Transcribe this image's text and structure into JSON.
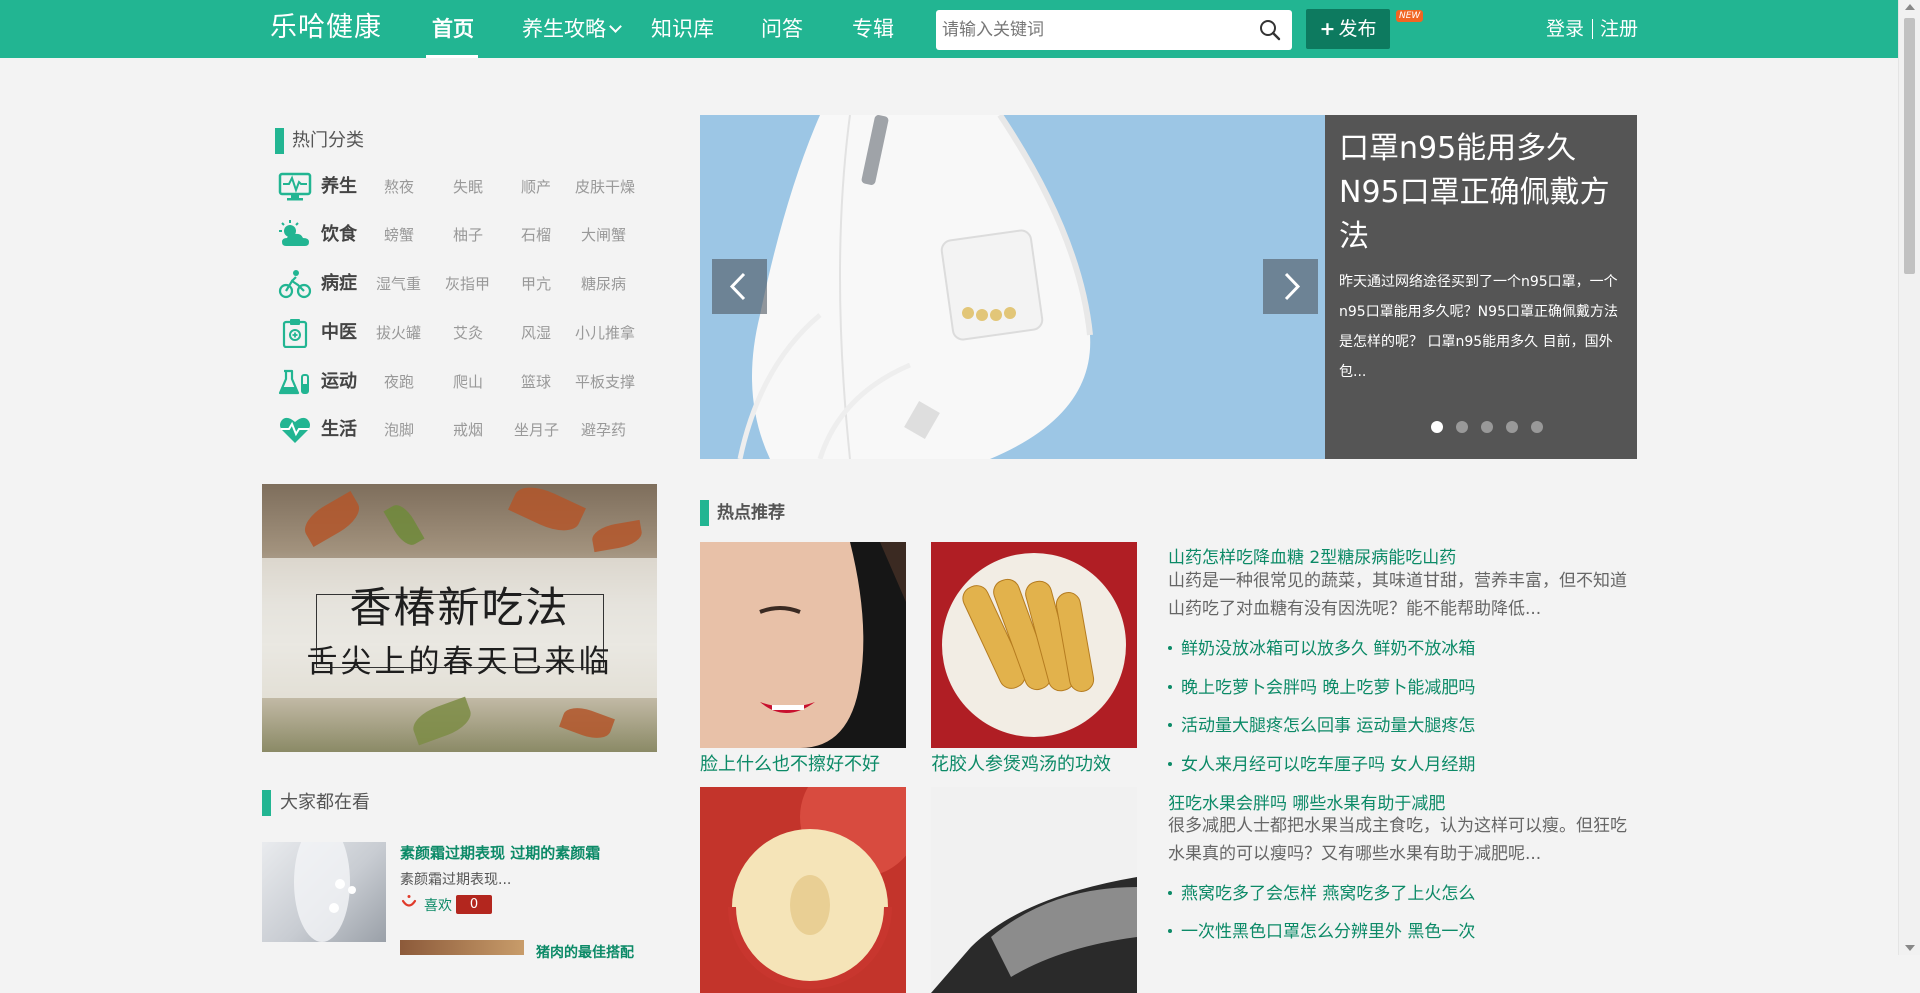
{
  "header": {
    "logo": "乐哈健康",
    "nav": [
      {
        "label": "首页",
        "active": true
      },
      {
        "label": "养生攻略",
        "has_dropdown": true
      },
      {
        "label": "知识库"
      },
      {
        "label": "问答"
      },
      {
        "label": "专辑"
      }
    ],
    "search_placeholder": "请输入关键词",
    "publish_label": "发布",
    "new_badge": "NEW",
    "login": "登录",
    "register": "注册"
  },
  "hot_categories": {
    "title": "热门分类",
    "rows": [
      {
        "icon": "monitor-pulse-icon",
        "name": "养生",
        "tags": [
          "熬夜",
          "失眠",
          "顺产",
          "皮肤干燥"
        ]
      },
      {
        "icon": "sun-cloud-icon",
        "name": "饮食",
        "tags": [
          "螃蟹",
          "柚子",
          "石榴",
          "大闸蟹"
        ]
      },
      {
        "icon": "cyclist-icon",
        "name": "病症",
        "tags": [
          "湿气重",
          "灰指甲",
          "甲亢",
          "糖尿病"
        ]
      },
      {
        "icon": "medical-clipboard-icon",
        "name": "中医",
        "tags": [
          "拔火罐",
          "艾灸",
          "风湿",
          "小儿推拿"
        ]
      },
      {
        "icon": "lab-flask-icon",
        "name": "运动",
        "tags": [
          "夜跑",
          "爬山",
          "篮球",
          "平板支撑"
        ]
      },
      {
        "icon": "heart-pulse-icon",
        "name": "生活",
        "tags": [
          "泡脚",
          "戒烟",
          "坐月子",
          "避孕药"
        ]
      }
    ]
  },
  "promo": {
    "line1": "香椿新吃法",
    "line2": "舌尖上的春天已来临"
  },
  "everyone_watching": {
    "title": "大家都在看",
    "items": [
      {
        "title": "素颜霜过期表现 过期的素颜霜",
        "desc": "素颜霜过期表现...",
        "like_label": "喜欢",
        "like_count": "0"
      },
      {
        "title": "猪肉的最佳搭配"
      }
    ]
  },
  "slider": {
    "title": "口罩n95能用多久 N95口罩正确佩戴方法",
    "desc": "昨天通过网络途径买到了一个n95口罩，一个n95口罩能用多久呢？N95口罩正确佩戴方法是怎样的呢？ 口罩n95能用多久 目前，国外包...",
    "dot_count": 5,
    "active_dot": 1
  },
  "hot_recommend": {
    "title": "热点推荐",
    "cards": [
      {
        "caption": "脸上什么也不擦好不好"
      },
      {
        "caption": "花胶人参煲鸡汤的功效"
      },
      {
        "caption": ""
      },
      {
        "caption": ""
      }
    ],
    "featured": [
      {
        "title": "山药怎样吃降血糖 2型糖尿病能吃山药",
        "desc": "山药是一种很常见的蔬菜，其味道甘甜，营养丰富，但不知道山药吃了对血糖有没有因洗呢？能不能帮助降低...",
        "links": [
          "鲜奶没放冰箱可以放多久 鲜奶不放冰箱",
          "晚上吃萝卜会胖吗 晚上吃萝卜能减肥吗",
          "活动量大腿疼怎么回事 运动量大腿疼怎",
          "女人来月经可以吃车厘子吗 女人月经期"
        ]
      },
      {
        "title": "狂吃水果会胖吗 哪些水果有助于减肥",
        "desc": "很多减肥人士都把水果当成主食吃，认为这样可以瘦。但狂吃水果真的可以瘦吗？又有哪些水果有助于减肥呢...",
        "links": [
          "燕窝吃多了会怎样 燕窝吃多了上火怎么",
          "一次性黑色口罩怎么分辨里外 黑色一次"
        ]
      }
    ]
  },
  "colors": {
    "brand": "#22b592",
    "link": "#0c8a67",
    "publish_bg": "#0d7a5f",
    "badge": "#f16522",
    "like_count_bg": "#b3261e",
    "slide_panel": "#555555"
  }
}
